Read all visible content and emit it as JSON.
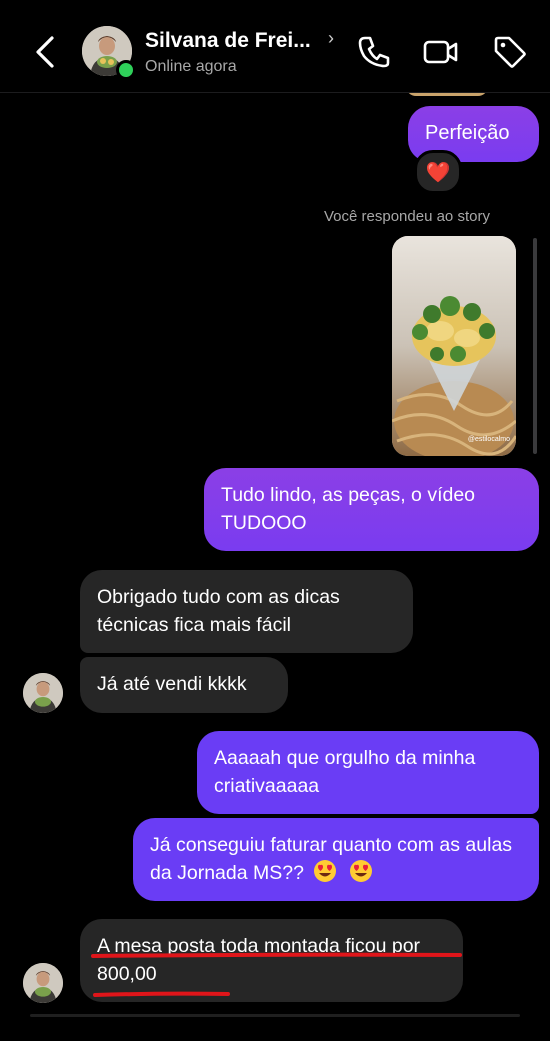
{
  "header": {
    "contact_name": "Silvana de Frei...",
    "status": "Online agora",
    "icons": [
      "back-chevron-icon",
      "phone-icon",
      "video-camera-icon",
      "tag-icon"
    ]
  },
  "messages": {
    "m1": {
      "text": "Perfeição",
      "reaction": "❤️"
    },
    "story_label": "Você respondeu ao story",
    "story_watermark": "@estilocalmo",
    "m2": {
      "text": "Tudo lindo, as peças, o vídeo TUDOOO"
    },
    "m3": {
      "text": "Obrigado  tudo com as dicas técnicas  fica mais fácil"
    },
    "m4": {
      "text": "Já até vendi kkkk"
    },
    "m5": {
      "text": "Aaaaah que orgulho da minha criativaaaaa"
    },
    "m6": {
      "text": "Já conseguiu faturar quanto com as aulas da Jornada MS??"
    },
    "m7": {
      "text": "A mesa posta toda montada ficou por 800,00"
    }
  },
  "colors": {
    "outgoing_top": "#8b3fe6",
    "outgoing_bottom": "#6a3df5",
    "incoming": "#262626",
    "online": "#2fd05a",
    "underline": "#e0151a"
  }
}
